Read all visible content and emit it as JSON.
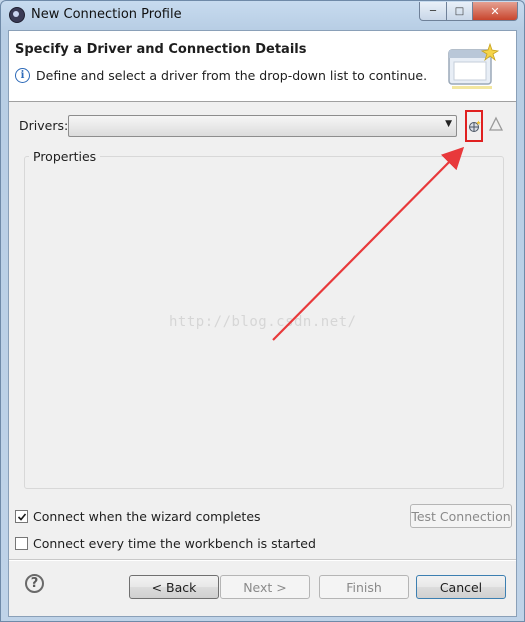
{
  "window": {
    "title": "New Connection Profile"
  },
  "banner": {
    "title": "Specify a Driver and Connection Details",
    "description": "Define and select a driver from the drop-down list to continue."
  },
  "drivers": {
    "label": "Drivers:",
    "selected": ""
  },
  "properties": {
    "label": "Properties"
  },
  "watermark": "http://blog.csdn.net/",
  "options": {
    "connect_on_finish": {
      "label": "Connect when the wizard completes",
      "checked": true
    },
    "connect_on_start": {
      "label": "Connect every time the workbench is started",
      "checked": false
    }
  },
  "buttons": {
    "test_connection": "Test Connection",
    "back": "< Back",
    "next": "Next >",
    "finish": "Finish",
    "cancel": "Cancel"
  },
  "colors": {
    "highlight": "#e02020",
    "arrow": "#e8393b"
  },
  "icons": [
    "app-icon",
    "minimize-icon",
    "maximize-icon",
    "close-icon",
    "info-icon",
    "wizard-image-icon",
    "dropdown-arrow-icon",
    "new-driver-icon",
    "edit-driver-icon",
    "help-icon"
  ]
}
